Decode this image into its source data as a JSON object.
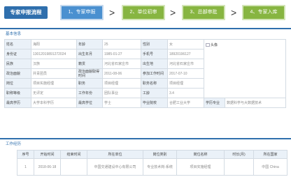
{
  "header": {
    "title": "专家申报流程",
    "steps": [
      {
        "label": "1、专家申报"
      },
      {
        "label": "2、单位初审"
      },
      {
        "label": "3、总部审批"
      },
      {
        "label": "4、专家入库"
      }
    ],
    "arrow": ">"
  },
  "basic": {
    "section_title": "基本信息",
    "photo_alt": "头像",
    "rows": [
      [
        {
          "l": "姓名",
          "v": "海阳"
        },
        {
          "l": "年龄",
          "v": "25"
        },
        {
          "l": "性别",
          "v": "女"
        }
      ],
      [
        {
          "l": "身份证",
          "v": "13012019891272024"
        },
        {
          "l": "出生年月",
          "v": "1985-01-27"
        },
        {
          "l": "手机号",
          "v": "18920196127"
        }
      ],
      [
        {
          "l": "民族",
          "v": "汉族"
        },
        {
          "l": "籍贯",
          "v": "河北省石家庄市"
        },
        {
          "l": "出生地",
          "v": "河北省石家庄市"
        }
      ],
      [
        {
          "l": "政治面貌",
          "v": "共青团员"
        },
        {
          "l": "政治面貌取得时间",
          "v": "2011-08-06"
        },
        {
          "l": "参加工作时间",
          "v": "2017-07-10"
        }
      ],
      [
        {
          "l": "岗位",
          "v": "项目实施经理"
        },
        {
          "l": "职务",
          "v": "项目经理"
        },
        {
          "l": "职务名称",
          "v": "项目经理"
        }
      ],
      [
        {
          "l": "职称等级",
          "v": "无评定"
        },
        {
          "l": "工作年份",
          "v": "团队事业"
        },
        {
          "l": "工龄",
          "v": "3.4"
        }
      ]
    ],
    "last_row": {
      "l1": "最高学历",
      "v1": "大学本科学历",
      "l2": "最高学位",
      "v2": "学士",
      "l3": "毕业院校",
      "v3": "合肥工业大学",
      "l4": "学历专业",
      "v4": "数据科学与大数据技术"
    }
  },
  "work": {
    "section_title": "工作经历",
    "headers": [
      "序号",
      "开始时间",
      "结束时间",
      "所在单位",
      "岗位类别",
      "岗位名称",
      "时长(月)",
      "所在国家"
    ],
    "rows": [
      [
        "1",
        "2018-06-18",
        "",
        "中国交通建设中心有限公司",
        "专业技术岗-系统",
        "项目实施经理",
        "",
        "中国 China"
      ]
    ]
  }
}
